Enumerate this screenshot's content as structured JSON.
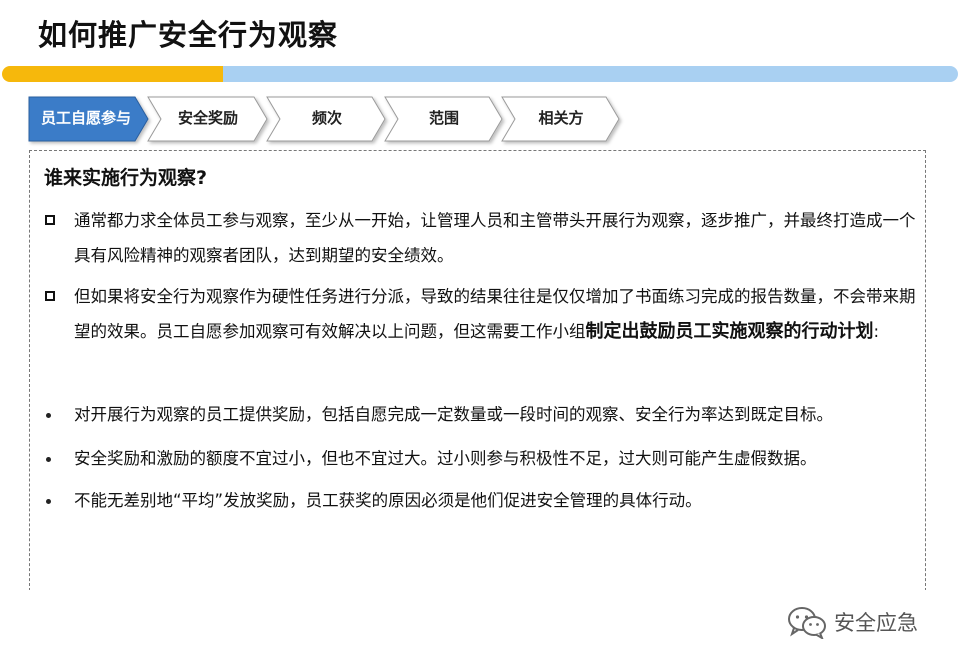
{
  "page": {
    "title": "如何推广安全行为观察"
  },
  "colors": {
    "title_bar_yellow": "#f6b80c",
    "title_bar_blue": "#a9d0f2",
    "tab_active": "#3a7bc8",
    "tab_inactive": "#ffffff"
  },
  "tabs": [
    {
      "label": "员工自愿参与",
      "active": true
    },
    {
      "label": "安全奖励",
      "active": false
    },
    {
      "label": "频次",
      "active": false
    },
    {
      "label": "范围",
      "active": false
    },
    {
      "label": "相关方",
      "active": false
    }
  ],
  "content": {
    "heading": "谁来实施行为观察?",
    "para1": "通常都力求全体员工参与观察，至少从一开始，让管理人员和主管带头开展行为观察，逐步推广，并最终打造成一个具有风险精神的观察者团队，达到期望的安全绩效。",
    "para2_normal": "但如果将安全行为观察作为硬性任务进行分派，导致的结果往往是仅仅增加了书面练习完成的报告数量，不会带来期望的效果。员工自愿参加观察可有效解决以上问题，但这需要工作小组",
    "para2_bold": "制定出鼓励员工实施观察的行动计划",
    "para2_end": ":",
    "bullets": [
      "对开展行为观察的员工提供奖励，包括自愿完成一定数量或一段时间的观察、安全行为率达到既定目标。",
      "安全奖励和激励的额度不宜过小，但也不宜过大。过小则参与积极性不足，过大则可能产生虚假数据。",
      "不能无差别地“平均”发放奖励，员工获奖的原因必须是他们促进安全管理的具体行动。"
    ]
  },
  "watermark": {
    "icon": "wechat-icon",
    "text": "安全应急"
  }
}
